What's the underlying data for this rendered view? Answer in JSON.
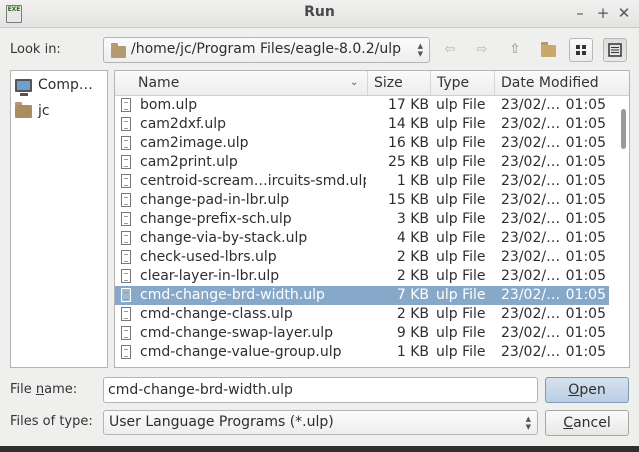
{
  "window": {
    "title": "Run",
    "minimize": "–",
    "maximize": "+",
    "close": "✕",
    "app_icon_text": "EXE"
  },
  "look_in": {
    "label": "Look in:",
    "path": "/home/jc/Program Files/eagle-8.0.2/ulp"
  },
  "toolbar": {
    "back": "⇦",
    "forward": "⇨",
    "up": "⇧"
  },
  "sidebar": {
    "items": [
      {
        "label": "Comp…",
        "icon": "computer-icon"
      },
      {
        "label": "jc",
        "icon": "folder-icon"
      }
    ]
  },
  "columns": {
    "name": "Name",
    "size": "Size",
    "type": "Type",
    "modified": "Date Modified"
  },
  "files": [
    {
      "name": "bom.ulp",
      "size": "17 KB",
      "type": "ulp File",
      "date": "23/02/…",
      "time": "01:05"
    },
    {
      "name": "cam2dxf.ulp",
      "size": "14 KB",
      "type": "ulp File",
      "date": "23/02/…",
      "time": "01:05"
    },
    {
      "name": "cam2image.ulp",
      "size": "16 KB",
      "type": "ulp File",
      "date": "23/02/…",
      "time": "01:05"
    },
    {
      "name": "cam2print.ulp",
      "size": "25 KB",
      "type": "ulp File",
      "date": "23/02/…",
      "time": "01:05"
    },
    {
      "name": "centroid-scream…ircuits-smd.ulp",
      "size": "1 KB",
      "type": "ulp File",
      "date": "23/02/…",
      "time": "01:05"
    },
    {
      "name": "change-pad-in-lbr.ulp",
      "size": "15 KB",
      "type": "ulp File",
      "date": "23/02/…",
      "time": "01:05"
    },
    {
      "name": "change-prefix-sch.ulp",
      "size": "3 KB",
      "type": "ulp File",
      "date": "23/02/…",
      "time": "01:05"
    },
    {
      "name": "change-via-by-stack.ulp",
      "size": "4 KB",
      "type": "ulp File",
      "date": "23/02/…",
      "time": "01:05"
    },
    {
      "name": "check-used-lbrs.ulp",
      "size": "2 KB",
      "type": "ulp File",
      "date": "23/02/…",
      "time": "01:05"
    },
    {
      "name": "clear-layer-in-lbr.ulp",
      "size": "2 KB",
      "type": "ulp File",
      "date": "23/02/…",
      "time": "01:05"
    },
    {
      "name": "cmd-change-brd-width.ulp",
      "size": "7 KB",
      "type": "ulp File",
      "date": "23/02/…",
      "time": "01:05",
      "selected": true
    },
    {
      "name": "cmd-change-class.ulp",
      "size": "2 KB",
      "type": "ulp File",
      "date": "23/02/…",
      "time": "01:05"
    },
    {
      "name": "cmd-change-swap-layer.ulp",
      "size": "9 KB",
      "type": "ulp File",
      "date": "23/02/…",
      "time": "01:05"
    },
    {
      "name": "cmd-change-value-group.ulp",
      "size": "1 KB",
      "type": "ulp File",
      "date": "23/02/…",
      "time": "01:05"
    }
  ],
  "file_name": {
    "label_prefix": "File ",
    "label_mnemonic": "n",
    "label_suffix": "ame:",
    "value": "cmd-change-brd-width.ulp"
  },
  "files_of_type": {
    "label": "Files of type:",
    "value": "User Language Programs (*.ulp)"
  },
  "buttons": {
    "open": {
      "mnemonic": "O",
      "rest": "pen"
    },
    "cancel": {
      "mnemonic": "C",
      "rest": "ancel"
    }
  },
  "colors": {
    "selection": "#86a8c9",
    "background": "#efefee"
  }
}
